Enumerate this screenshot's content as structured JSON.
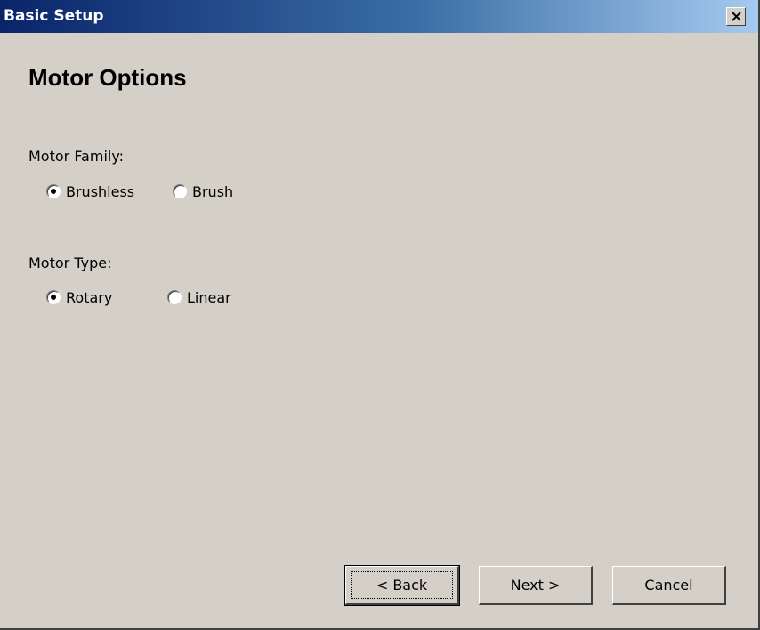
{
  "window": {
    "title": "Basic Setup",
    "close_icon": "close-icon"
  },
  "page": {
    "heading": "Motor Options"
  },
  "motor_family": {
    "label": "Motor Family:",
    "options": [
      {
        "label": "Brushless",
        "selected": true
      },
      {
        "label": "Brush",
        "selected": false
      }
    ]
  },
  "motor_type": {
    "label": "Motor Type:",
    "options": [
      {
        "label": "Rotary",
        "selected": true
      },
      {
        "label": "Linear",
        "selected": false
      }
    ]
  },
  "buttons": {
    "back": "< Back",
    "next": "Next >",
    "cancel": "Cancel"
  }
}
